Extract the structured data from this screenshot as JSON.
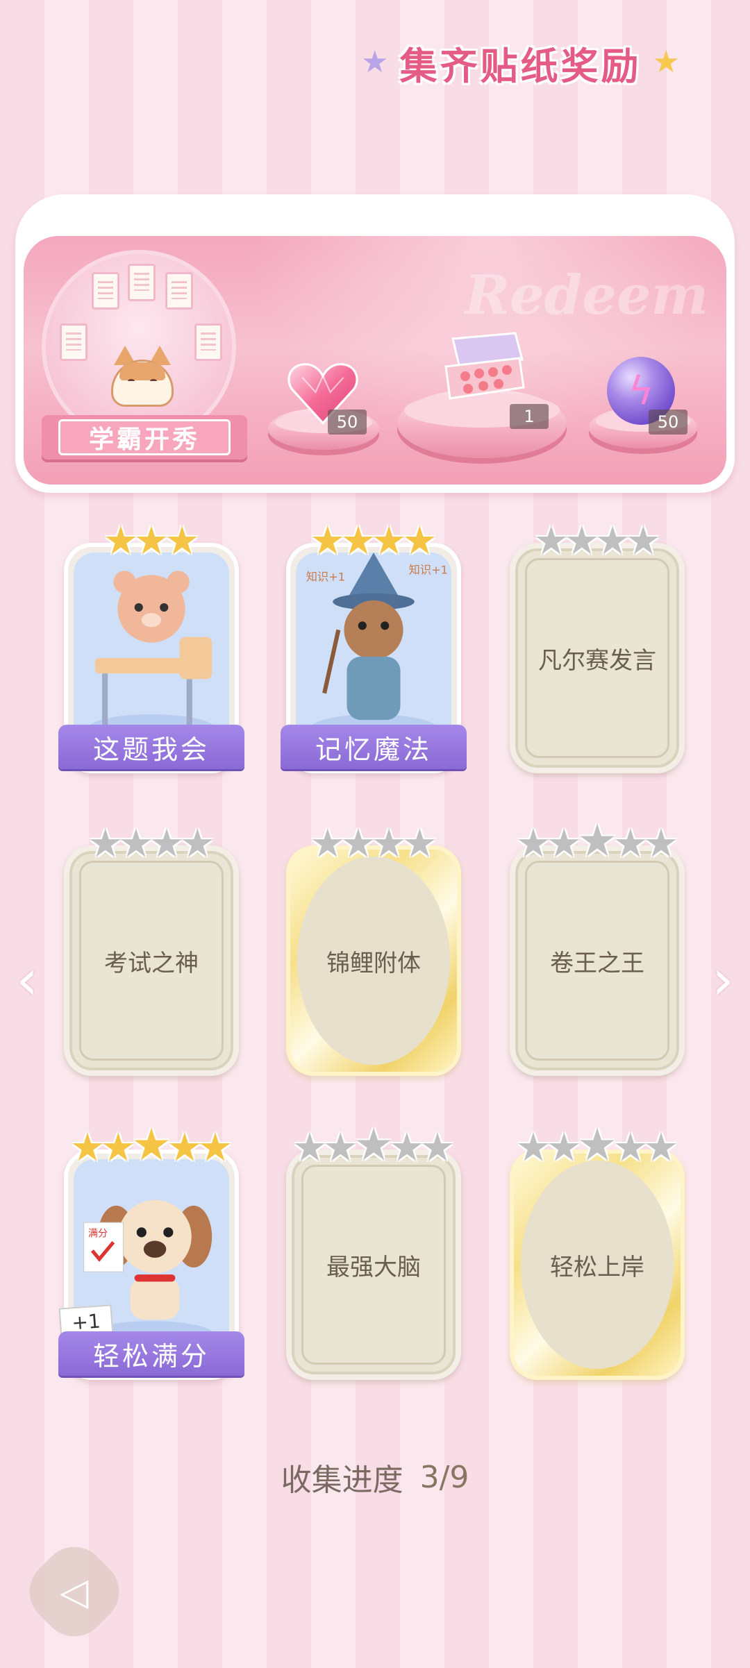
{
  "banner": {
    "title": "集齐贴纸奖励",
    "watermark": "Redeem",
    "avatar_label": "学霸开秀",
    "rewards": [
      {
        "icon": "pink-heart-gem-icon",
        "count": "50"
      },
      {
        "icon": "gift-box-icon",
        "count": "1"
      },
      {
        "icon": "purple-lightning-orb-icon",
        "count": "50"
      }
    ]
  },
  "stickers": [
    {
      "label": "这题我会",
      "collected": true,
      "stars_lit": 3,
      "stars_total": 3,
      "art": "bear-at-desk"
    },
    {
      "label": "记忆魔法",
      "collected": true,
      "stars_lit": 4,
      "stars_total": 4,
      "art": "otter-wizard",
      "art_text": "知识+1"
    },
    {
      "label": "凡尔赛发言",
      "collected": false,
      "stars_lit": 0,
      "stars_total": 4,
      "frame": "plain"
    },
    {
      "label": "考试之神",
      "collected": false,
      "stars_lit": 0,
      "stars_total": 4,
      "frame": "plain"
    },
    {
      "label": "锦鲤附体",
      "collected": false,
      "stars_lit": 0,
      "stars_total": 4,
      "frame": "gold"
    },
    {
      "label": "卷王之王",
      "collected": false,
      "stars_lit": 0,
      "stars_total": 5,
      "frame": "plain"
    },
    {
      "label": "轻松满分",
      "collected": true,
      "stars_lit": 5,
      "stars_total": 5,
      "art": "puppy-full-score",
      "art_text": "满分",
      "tag": "+1"
    },
    {
      "label": "最强大脑",
      "collected": false,
      "stars_lit": 0,
      "stars_total": 5,
      "frame": "plain"
    },
    {
      "label": "轻松上岸",
      "collected": false,
      "stars_lit": 0,
      "stars_total": 5,
      "frame": "gold"
    }
  ],
  "progress": {
    "label": "收集进度",
    "value": "3/9"
  },
  "nav": {
    "prev_icon": "chevron-left-icon",
    "next_icon": "chevron-right-icon",
    "back_icon": "back-arrow-icon"
  },
  "colors": {
    "accent_pink": "#e45c86",
    "name_banner_purple": "#8a6ad6",
    "star_gold": "#f5c445",
    "star_grey": "#bfbfbf"
  }
}
